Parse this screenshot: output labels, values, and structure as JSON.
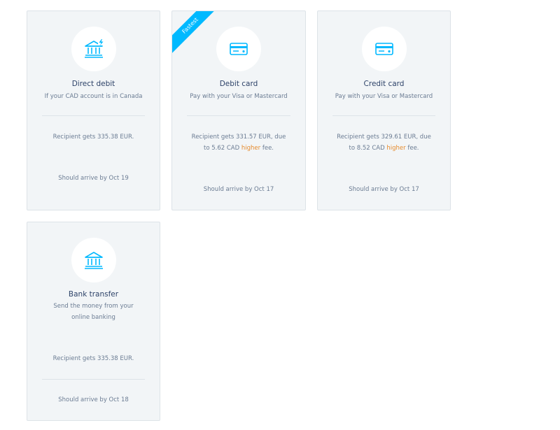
{
  "colors": {
    "card_background": "#f2f5f7",
    "card_border": "#dde3e8",
    "icon_blue": "#00b9ff",
    "highlight_orange": "#e68b2d",
    "title_text": "#2e4369",
    "body_text": "#6b7c93"
  },
  "cards": [
    {
      "icon": "bank-bolt-icon",
      "title": "Direct debit",
      "subtitle": "If your CAD account is in Canada",
      "recipient_text": "Recipient gets 335.38 EUR.",
      "arrival": "Should arrive by Oct 19"
    },
    {
      "icon": "card-icon",
      "badge": "Fastest",
      "title": "Debit card",
      "subtitle": "Pay with your Visa or Mastercard",
      "recipient_text_line1": "Recipient gets 331.57 EUR, due",
      "recipient_text_line2_prefix": "to 5.62 CAD",
      "recipient_text_highlight": "higher",
      "recipient_text_line2_suffix": "fee.",
      "arrival": "Should arrive by Oct 17"
    },
    {
      "icon": "card-icon",
      "title": "Credit card",
      "subtitle": "Pay with your Visa or Mastercard",
      "recipient_text_line1": "Recipient gets 329.61 EUR, due",
      "recipient_text_line2_prefix": "to 8.52 CAD",
      "recipient_text_highlight": "higher",
      "recipient_text_line2_suffix": "fee.",
      "arrival": "Should arrive by Oct 17"
    },
    {
      "icon": "bank-icon",
      "title": "Bank transfer",
      "subtitle_line1": "Send the money from your",
      "subtitle_line2": "online banking",
      "recipient_text": "Recipient gets 335.38 EUR.",
      "arrival": "Should arrive by Oct 18"
    }
  ]
}
